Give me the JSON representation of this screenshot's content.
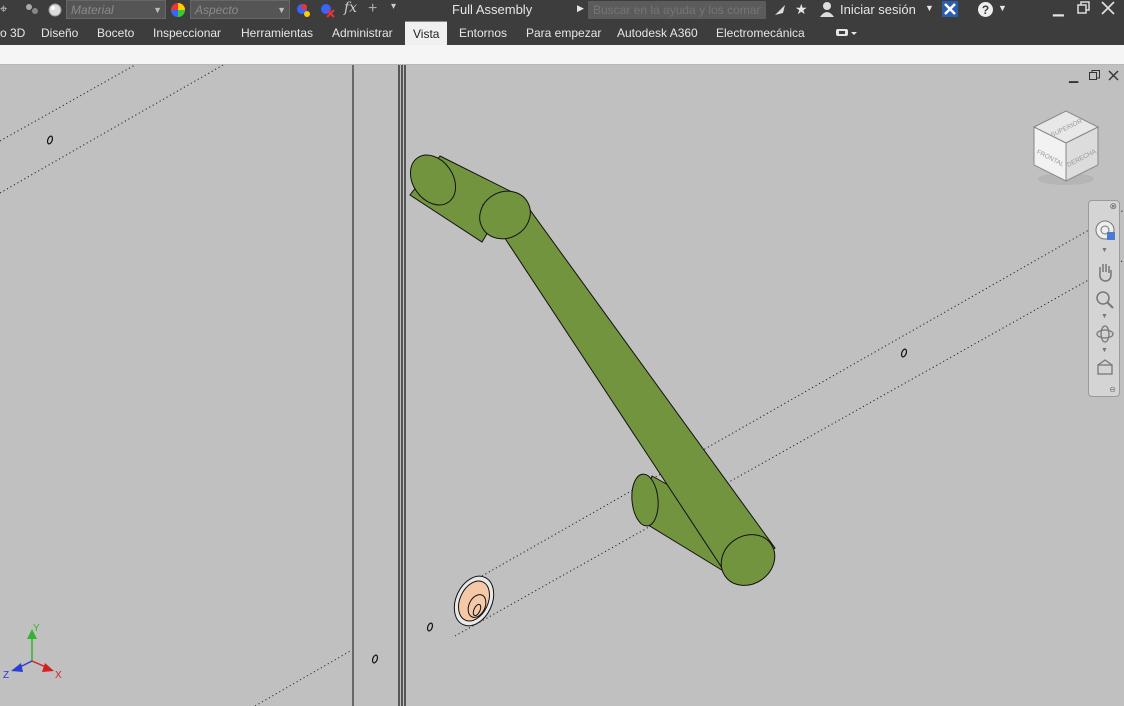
{
  "quick_access": {
    "material_placeholder": "Material",
    "appearance_placeholder": "Aspecto",
    "fx_label": "fx"
  },
  "app": {
    "document_title": "Full Assembly",
    "search_placeholder": "Buscar en la ayuda y los comanc",
    "signin_label": "Iniciar sesión",
    "help_label": "?"
  },
  "ribbon": {
    "tabs": [
      {
        "label": "o 3D"
      },
      {
        "label": "Diseño"
      },
      {
        "label": "Boceto"
      },
      {
        "label": "Inspeccionar"
      },
      {
        "label": "Herramientas"
      },
      {
        "label": "Administrar"
      },
      {
        "label": "Vista",
        "active": true
      },
      {
        "label": "Entornos"
      },
      {
        "label": "Para empezar"
      },
      {
        "label": "Autodesk A360"
      },
      {
        "label": "Electromecánica"
      }
    ]
  },
  "viewcube": {
    "top": "SUPERIOR",
    "front": "FRONTAL",
    "right": "DERECHA"
  },
  "triad": {
    "x": "X",
    "y": "Y",
    "z": "Z"
  },
  "colors": {
    "chrome": "#3d3d3d",
    "viewport": "#c0c0c0",
    "part_green": "#72943f",
    "part_skin": "#f5c9a8",
    "axis_x": "#d42020",
    "axis_y": "#2fb52f",
    "axis_z": "#2a3fd0"
  }
}
